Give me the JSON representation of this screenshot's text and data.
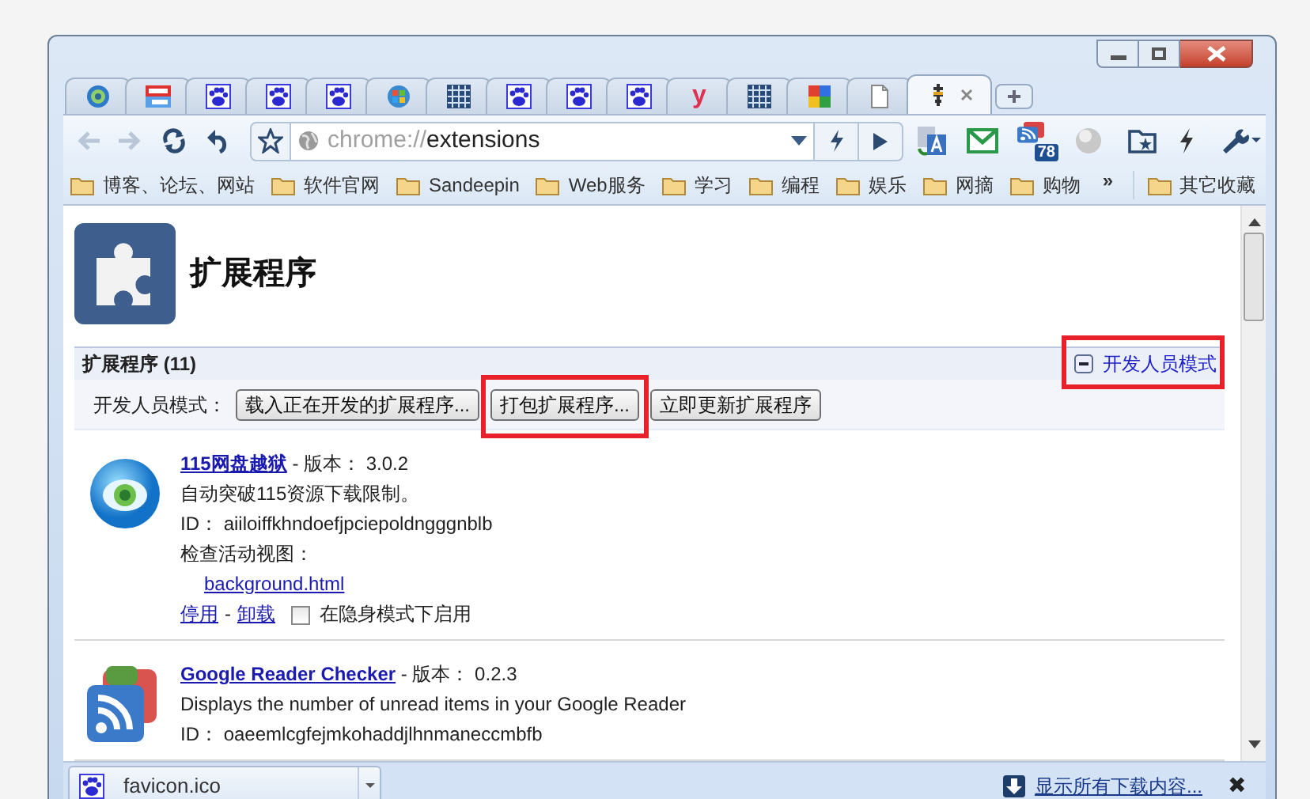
{
  "tabs": [
    {
      "kind": "ring",
      "selected": false
    },
    {
      "kind": "tile",
      "selected": false
    },
    {
      "kind": "paw",
      "selected": false
    },
    {
      "kind": "paw",
      "selected": false
    },
    {
      "kind": "paw",
      "selected": false
    },
    {
      "kind": "orb",
      "selected": false
    },
    {
      "kind": "grid",
      "selected": false
    },
    {
      "kind": "paw",
      "selected": false
    },
    {
      "kind": "paw",
      "selected": false
    },
    {
      "kind": "paw",
      "selected": false
    },
    {
      "kind": "glyph",
      "glyph": "y",
      "selected": false
    },
    {
      "kind": "grid",
      "selected": false
    },
    {
      "kind": "quad",
      "selected": false
    },
    {
      "kind": "page",
      "selected": false
    },
    {
      "kind": "pin",
      "selected": true
    }
  ],
  "toolbar": {
    "url_scheme": "chrome://",
    "url_path": "extensions",
    "reader_badge": "78"
  },
  "bookmarks": [
    {
      "label": "博客、论坛、网站"
    },
    {
      "label": "软件官网"
    },
    {
      "label": "Sandeepin"
    },
    {
      "label": "Web服务"
    },
    {
      "label": "学习"
    },
    {
      "label": "编程"
    },
    {
      "label": "娱乐"
    },
    {
      "label": "网摘"
    },
    {
      "label": "购物"
    }
  ],
  "bookmarks_more": "»",
  "other_bookmarks": "其它收藏",
  "page": {
    "title": "扩展程序",
    "section_title": "扩展程序 (11)",
    "developer_mode_link": {
      "label": "开发人员模式",
      "expanded": true,
      "highlighted": true
    },
    "developer_label": "开发人员模式：",
    "buttons": [
      {
        "label": "载入正在开发的扩展程序...",
        "highlighted": false
      },
      {
        "label": "打包扩展程序...",
        "highlighted": true
      },
      {
        "label": "立即更新扩展程序",
        "highlighted": false
      }
    ],
    "extensions": [
      {
        "kind": "eye",
        "name": "115网盘越狱",
        "version_label": "- 版本：",
        "version": "3.0.2",
        "description": "自动突破115资源下载限制。",
        "id_label": "ID：",
        "id": "aiiloiffkhndoefjpciepoldngggnblb",
        "views_label": "检查活动视图：",
        "views": [
          "background.html"
        ],
        "actions": [
          "停用",
          "卸载"
        ],
        "action_separator": "-",
        "incognito": {
          "label": "在隐身模式下启用",
          "checked": false
        }
      },
      {
        "kind": "feed",
        "name": "Google Reader Checker",
        "version_label": "- 版本：",
        "version": "0.2.3",
        "description": "Displays the number of unread items in your Google Reader",
        "id_label": "ID：",
        "id": "oaeemlcgfejmkohaddjlhnmaneccmbfb"
      }
    ]
  },
  "download_shelf": {
    "items": [
      {
        "name": "favicon.ico"
      }
    ],
    "show_all": "显示所有下载内容...",
    "close": "✖"
  }
}
